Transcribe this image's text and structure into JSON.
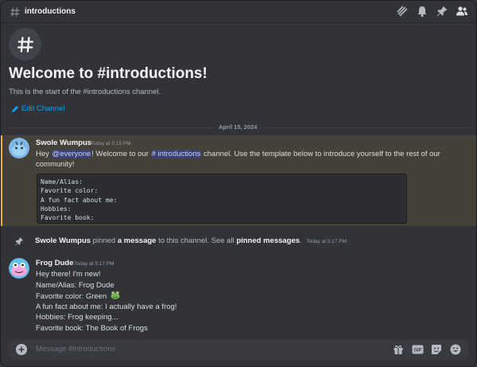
{
  "header": {
    "channel_name": "introductions",
    "icons": [
      "hash-icon",
      "threads-icon",
      "bell-icon",
      "pin-icon",
      "members-icon"
    ]
  },
  "welcome": {
    "title": "Welcome to #introductions!",
    "subtitle": "This is the start of the #introductions channel.",
    "edit_label": "Edit Channel"
  },
  "date_divider": "April 15, 2024",
  "messages": [
    {
      "author": "Swole Wumpus",
      "timestamp": "Today at 5:15 PM",
      "text_parts": {
        "before": "Hey ",
        "mention_everyone": "@everyone",
        "middle": "! Welcome to our ",
        "mention_channel": "# introductions",
        "after": " channel. Use the template below to introduce yourself to the rest of our",
        "line2": "community!"
      },
      "code_lines": [
        "Name/Alias:",
        "Favorite color:",
        "A fun fact about me:",
        "Hobbies:",
        "Favorite book:"
      ]
    },
    {
      "author": "Frog Dude",
      "timestamp": "Today at 5:17 PM",
      "lines": [
        "Hey there! I'm new!",
        "Name/Alias: Frog Dude",
        "Favorite color: Green",
        "A fun fact about me: I actually have a frog!",
        "Hobbies: Frog keeping...",
        "Favorite book: The Book of Frogs"
      ]
    }
  ],
  "system_message": {
    "author": "Swole Wumpus",
    "text1": " pinned ",
    "link1": "a message",
    "text2": " to this channel. See all ",
    "link2": "pinned messages",
    "text3": ".",
    "timestamp": "Today at 5:17 PM"
  },
  "composer": {
    "placeholder": "Message #introductions"
  },
  "colors": {
    "background": "#313338",
    "highlight": "#444138",
    "highlight_bar": "#f0b232",
    "link": "#00a8fc",
    "mention_bg": "#3c4270"
  }
}
